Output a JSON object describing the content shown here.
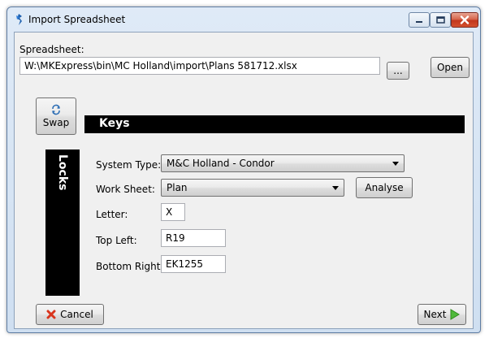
{
  "window": {
    "title": "Import Spreadsheet"
  },
  "spreadsheet": {
    "label": "Spreadsheet:",
    "path": "W:\\MKExpress\\bin\\MC Holland\\import\\Plans 581712.xlsx",
    "browse_label": "...",
    "open_label": "Open"
  },
  "swap": {
    "label": "Swap"
  },
  "keys": {
    "title": "Keys"
  },
  "locks": {
    "title": "Locks"
  },
  "form": {
    "system_type": {
      "label": "System Type:",
      "value": "M&C Holland - Condor"
    },
    "work_sheet": {
      "label": "Work Sheet:",
      "value": "Plan",
      "analyse_label": "Analyse"
    },
    "letter": {
      "label": "Letter:",
      "value": "X"
    },
    "top_left": {
      "label": "Top Left:",
      "value": "R19"
    },
    "bottom_right": {
      "label": "Bottom Right:",
      "value": "EK1255"
    }
  },
  "footer": {
    "cancel_label": "Cancel",
    "next_label": "Next"
  }
}
